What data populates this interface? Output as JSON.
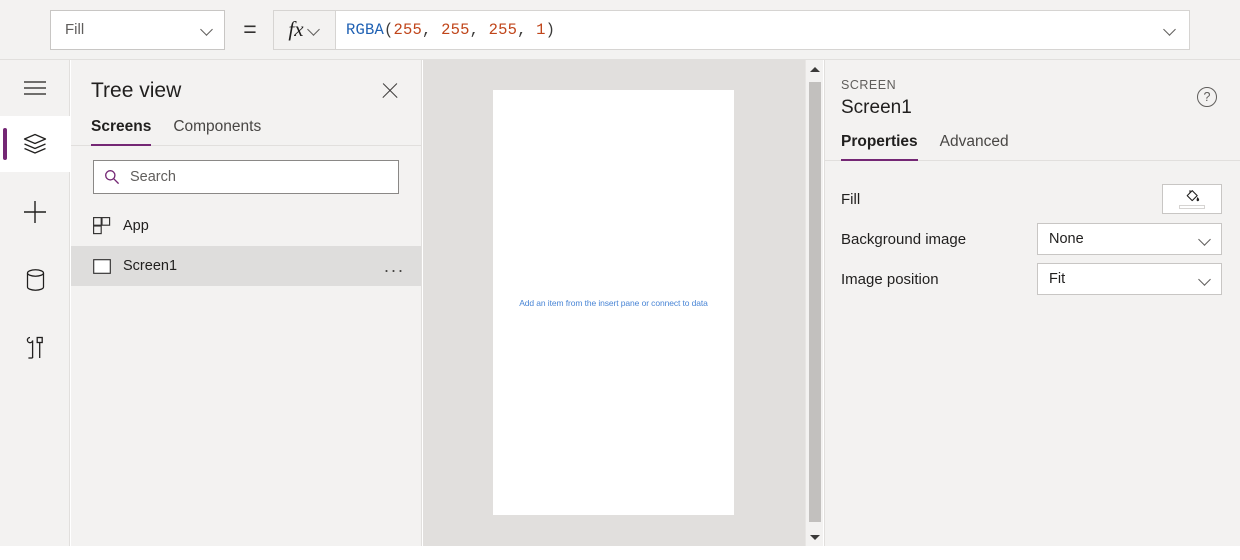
{
  "formula_bar": {
    "property_selector": {
      "value": "Fill",
      "icon": "chevron-down-icon"
    },
    "equals": "=",
    "fx_label": "fx",
    "formula_tokens": [
      {
        "text": "RGBA",
        "type": "fn"
      },
      {
        "text": "(",
        "type": "punct"
      },
      {
        "text": "255",
        "type": "num"
      },
      {
        "text": ", ",
        "type": "punct"
      },
      {
        "text": "255",
        "type": "num"
      },
      {
        "text": ", ",
        "type": "punct"
      },
      {
        "text": "255",
        "type": "num"
      },
      {
        "text": ", ",
        "type": "punct"
      },
      {
        "text": "1",
        "type": "num"
      },
      {
        "text": ")",
        "type": "punct"
      }
    ],
    "formula_plain": "RGBA(255, 255, 255, 1)"
  },
  "rail": {
    "items": [
      {
        "name": "hamburger-menu",
        "icon": "hamburger-icon",
        "active": false
      },
      {
        "name": "tree-view",
        "icon": "layers-icon",
        "active": true
      },
      {
        "name": "insert",
        "icon": "plus-icon",
        "active": false
      },
      {
        "name": "data",
        "icon": "database-icon",
        "active": false
      },
      {
        "name": "advanced-tools",
        "icon": "tools-icon",
        "active": false
      }
    ]
  },
  "tree_panel": {
    "title": "Tree view",
    "close_label": "Close",
    "tabs": [
      {
        "label": "Screens",
        "active": true
      },
      {
        "label": "Components",
        "active": false
      }
    ],
    "search": {
      "placeholder": "Search",
      "value": ""
    },
    "items": [
      {
        "label": "App",
        "icon": "app-grid-icon",
        "selected": false,
        "has_overflow": false
      },
      {
        "label": "Screen1",
        "icon": "screen-rect-icon",
        "selected": true,
        "has_overflow": true,
        "overflow_label": "..."
      }
    ]
  },
  "canvas": {
    "hint": "Add an item from the insert pane or connect to data",
    "hint_color": "#4a86d6",
    "screen_fill": "#ffffff",
    "background": "#e1dfdd",
    "scrollbar": {
      "up": "▲",
      "down": "▼"
    }
  },
  "properties_panel": {
    "kicker": "SCREEN",
    "title": "Screen1",
    "help_glyph": "?",
    "tabs": [
      {
        "label": "Properties",
        "active": true
      },
      {
        "label": "Advanced",
        "active": false
      }
    ],
    "rows": [
      {
        "label": "Fill",
        "control": "color",
        "value": "#ffffff"
      },
      {
        "label": "Background image",
        "control": "dropdown",
        "value": "None"
      },
      {
        "label": "Image position",
        "control": "dropdown",
        "value": "Fit"
      }
    ]
  },
  "theme": {
    "accent": "#742774",
    "panel_bg": "#f3f2f1",
    "canvas_bg": "#e1dfdd",
    "border": "#e1dfdd",
    "text": "#201f1e"
  }
}
